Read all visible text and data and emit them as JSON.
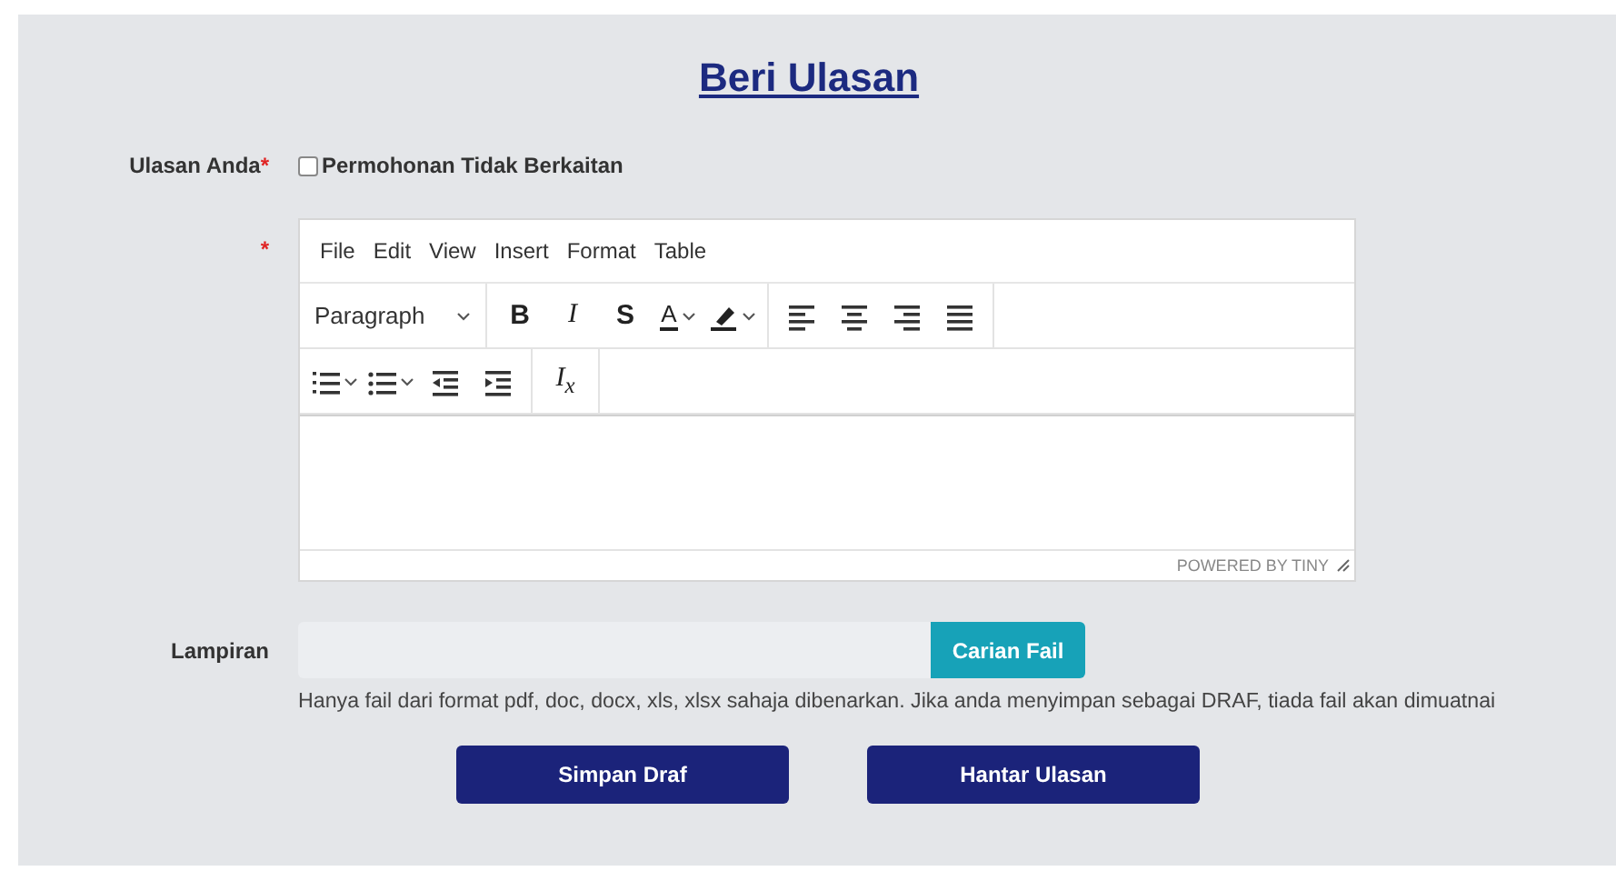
{
  "title": "Beri Ulasan",
  "review": {
    "label": "Ulasan Anda",
    "required_mark": "*",
    "checkbox": {
      "label": "Permohonan Tidak Berkaitan",
      "checked": false
    }
  },
  "editor": {
    "required_mark": "*",
    "menu": [
      "File",
      "Edit",
      "View",
      "Insert",
      "Format",
      "Table"
    ],
    "block_format": "Paragraph",
    "toolbar_rows": [
      [
        [
          {
            "kind": "bold",
            "label": "B"
          },
          {
            "kind": "italic",
            "label": "I"
          },
          {
            "kind": "strikethrough",
            "label": "S"
          },
          {
            "kind": "text-color",
            "label": "A",
            "split": true
          },
          {
            "kind": "highlight",
            "split": true
          }
        ],
        [
          {
            "kind": "align-left"
          },
          {
            "kind": "align-center"
          },
          {
            "kind": "align-right"
          },
          {
            "kind": "justify"
          }
        ]
      ],
      [
        [
          {
            "kind": "numbered-list",
            "split": true
          },
          {
            "kind": "bullet-list",
            "split": true
          },
          {
            "kind": "outdent"
          },
          {
            "kind": "indent"
          }
        ],
        [
          {
            "kind": "clear-format",
            "label": "I$_{x}$"
          }
        ]
      ]
    ],
    "branding": "POWERED BY TINY"
  },
  "attachment": {
    "label": "Lampiran",
    "button": "Carian Fail",
    "help": "Hanya fail dari format pdf, doc, docx, xls, xlsx sahaja dibenarkan. Jika anda menyimpan sebagai DRAF, tiada fail akan dimuatnai"
  },
  "buttons": [
    "Simpan Draf",
    "Hantar Ulasan"
  ]
}
